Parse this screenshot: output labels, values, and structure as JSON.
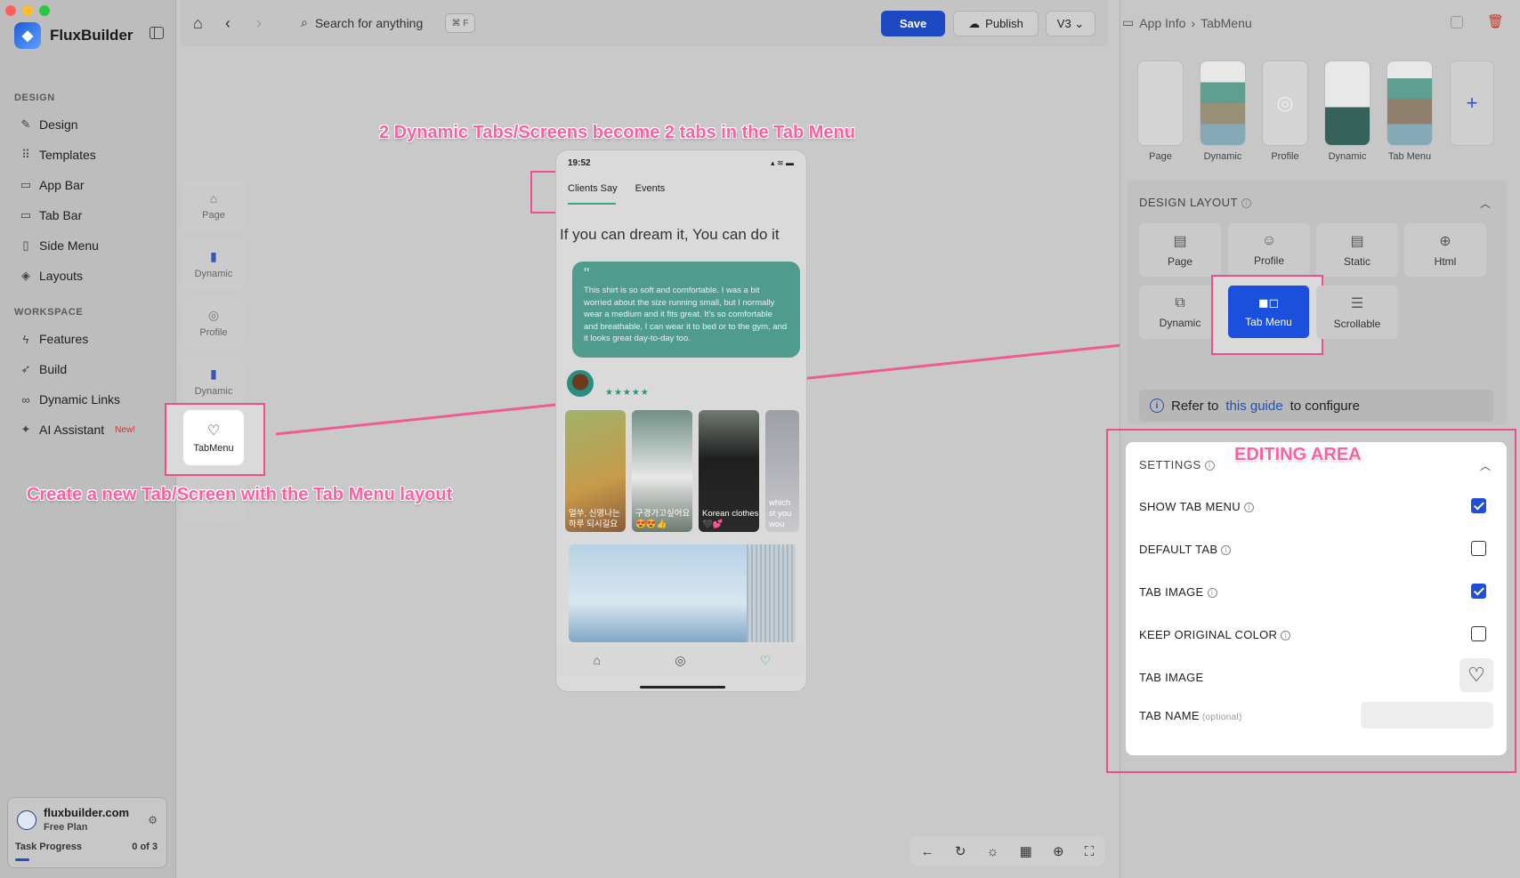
{
  "window": {
    "traffic_colors": [
      "#ff5f57",
      "#febc2e",
      "#28c840"
    ]
  },
  "sidebar": {
    "brand": "FluxBuilder",
    "sections": [
      {
        "title": "DESIGN",
        "items": [
          {
            "label": "Design",
            "icon": "pen-icon"
          },
          {
            "label": "Templates",
            "icon": "grid-icon"
          },
          {
            "label": "App Bar",
            "icon": "appbar-icon"
          },
          {
            "label": "Tab Bar",
            "icon": "tabbar-icon"
          },
          {
            "label": "Side Menu",
            "icon": "sidemenu-icon"
          },
          {
            "label": "Layouts",
            "icon": "layers-icon"
          }
        ]
      },
      {
        "title": "WORKSPACE",
        "items": [
          {
            "label": "Features",
            "icon": "bolt-icon"
          },
          {
            "label": "Build",
            "icon": "rocket-icon"
          },
          {
            "label": "Dynamic Links",
            "icon": "link-icon"
          },
          {
            "label": "AI Assistant",
            "icon": "sparkle-icon",
            "badge": "New!"
          }
        ]
      }
    ],
    "account": {
      "domain": "fluxbuilder.com",
      "plan": "Free Plan",
      "task_label": "Task Progress",
      "task_count": "0 of 3",
      "task_progress": 0.1
    }
  },
  "topbar": {
    "search_placeholder": "Search for anything",
    "shortcut": "⌘ F",
    "save_label": "Save",
    "publish_label": "Publish",
    "version_label": "V3"
  },
  "screens": [
    {
      "label": "Page",
      "type": "page"
    },
    {
      "label": "Dynamic",
      "type": "dyn"
    },
    {
      "label": "Profile",
      "type": "profile"
    },
    {
      "label": "Dynamic",
      "type": "dyn"
    },
    {
      "label": "TabMenu",
      "type": "tab"
    }
  ],
  "annotations": {
    "top": "2 Dynamic Tabs/Screens become 2 tabs in the Tab Menu",
    "left": "Create a new Tab/Screen with the Tab Menu layout",
    "right": "EDITING AREA"
  },
  "phone": {
    "time": "19:52",
    "tabs": [
      "Clients Say",
      "Events"
    ],
    "headline": "If you can dream it, You can do it",
    "quote": "This shirt is so soft and comfortable. I was a bit worried about the size running small, but I normally wear a medium and it fits great. It's so comfortable and breathable, I can wear it to bed or to the gym, and it looks great day-to-day too.",
    "stars": "★★★★★",
    "images": [
      {
        "caption": "얼쑤, 신명나는 하루 되시길요",
        "color": "#c79a4a"
      },
      {
        "caption": "구경가고싶어요 😍😍👍",
        "color": "#6f8f84"
      },
      {
        "caption": "Korean clothes 🖤💕",
        "color": "#2a2a2a"
      },
      {
        "caption": "which st you wou",
        "color": "#9d9fa8"
      }
    ]
  },
  "right_panel": {
    "breadcrumb": [
      "App Info",
      "TabMenu"
    ],
    "thumbnails": [
      {
        "label": "Page"
      },
      {
        "label": "Dynamic"
      },
      {
        "label": "Profile"
      },
      {
        "label": "Dynamic"
      },
      {
        "label": "Tab Menu"
      }
    ],
    "add_label": "+",
    "design_layout_title": "DESIGN LAYOUT",
    "layouts": [
      {
        "label": "Page",
        "icon": "page-icon"
      },
      {
        "label": "Profile",
        "icon": "user-icon"
      },
      {
        "label": "Static",
        "icon": "static-icon"
      },
      {
        "label": "Html",
        "icon": "globe-icon"
      },
      {
        "label": "Dynamic",
        "icon": "dynamic-icon"
      },
      {
        "label": "Tab Menu",
        "icon": "tabmenu-icon",
        "selected": true
      },
      {
        "label": "Scrollable",
        "icon": "scroll-icon"
      }
    ],
    "refer_prefix": "Refer to",
    "refer_link": "this guide",
    "refer_suffix": "to configure",
    "settings_title": "SETTINGS",
    "settings": [
      {
        "label": "SHOW TAB MENU",
        "checked": true
      },
      {
        "label": "DEFAULT TAB",
        "checked": false
      },
      {
        "label": "TAB IMAGE",
        "checked": true
      },
      {
        "label": "KEEP ORIGINAL COLOR",
        "checked": false
      }
    ],
    "tab_image_label": "TAB IMAGE",
    "tab_name_label": "TAB NAME",
    "tab_name_optional": "(optional)",
    "tab_name_value": ""
  },
  "colors": {
    "accent": "#1c48c2",
    "annotation": "#ee4d8f",
    "quote_bg": "#4f9b8e"
  }
}
